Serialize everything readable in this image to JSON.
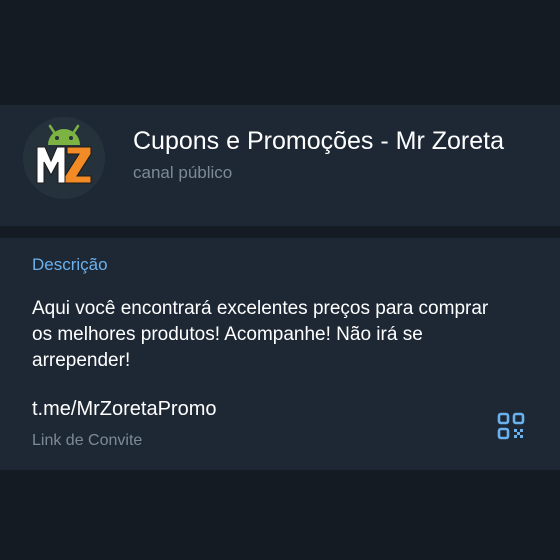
{
  "colors": {
    "background": "#141b23",
    "card": "#1e2835",
    "accent": "#6ab1ee",
    "text_primary": "#ffffff",
    "text_secondary": "#7c8a98"
  },
  "channel": {
    "avatar_icon": "mz-logo-android-icon",
    "title": "Cupons e Promoções - Mr Zoreta",
    "subtitle": "canal público"
  },
  "info": {
    "description_label": "Descrição",
    "description_text": "Aqui você encontrará excelentes preços para comprar os melhores produtos! Acompanhe! Não irá se arrepender!",
    "link": "t.me/MrZoretaPromo",
    "link_caption": "Link de Convite",
    "qr_icon": "qr-code-icon"
  }
}
